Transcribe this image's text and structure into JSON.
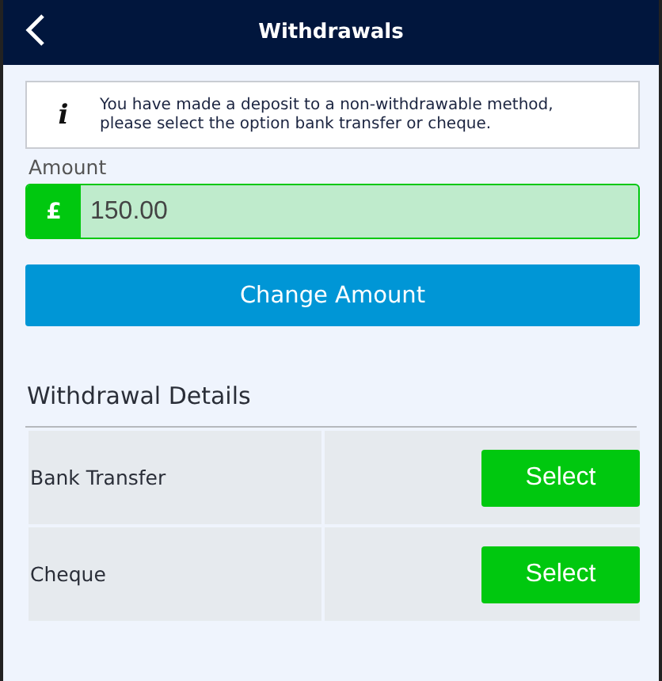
{
  "header": {
    "title": "Withdrawals"
  },
  "notice": {
    "icon": "i",
    "text": "You have made a deposit to a non-withdrawable method, please select the option bank transfer or cheque."
  },
  "amount": {
    "label": "Amount",
    "currency": "£",
    "value": "150.00"
  },
  "change_button": "Change Amount",
  "details": {
    "title": "Withdrawal Details",
    "methods": [
      {
        "name": "Bank Transfer",
        "action": "Select"
      },
      {
        "name": "Cheque",
        "action": "Select"
      }
    ]
  }
}
